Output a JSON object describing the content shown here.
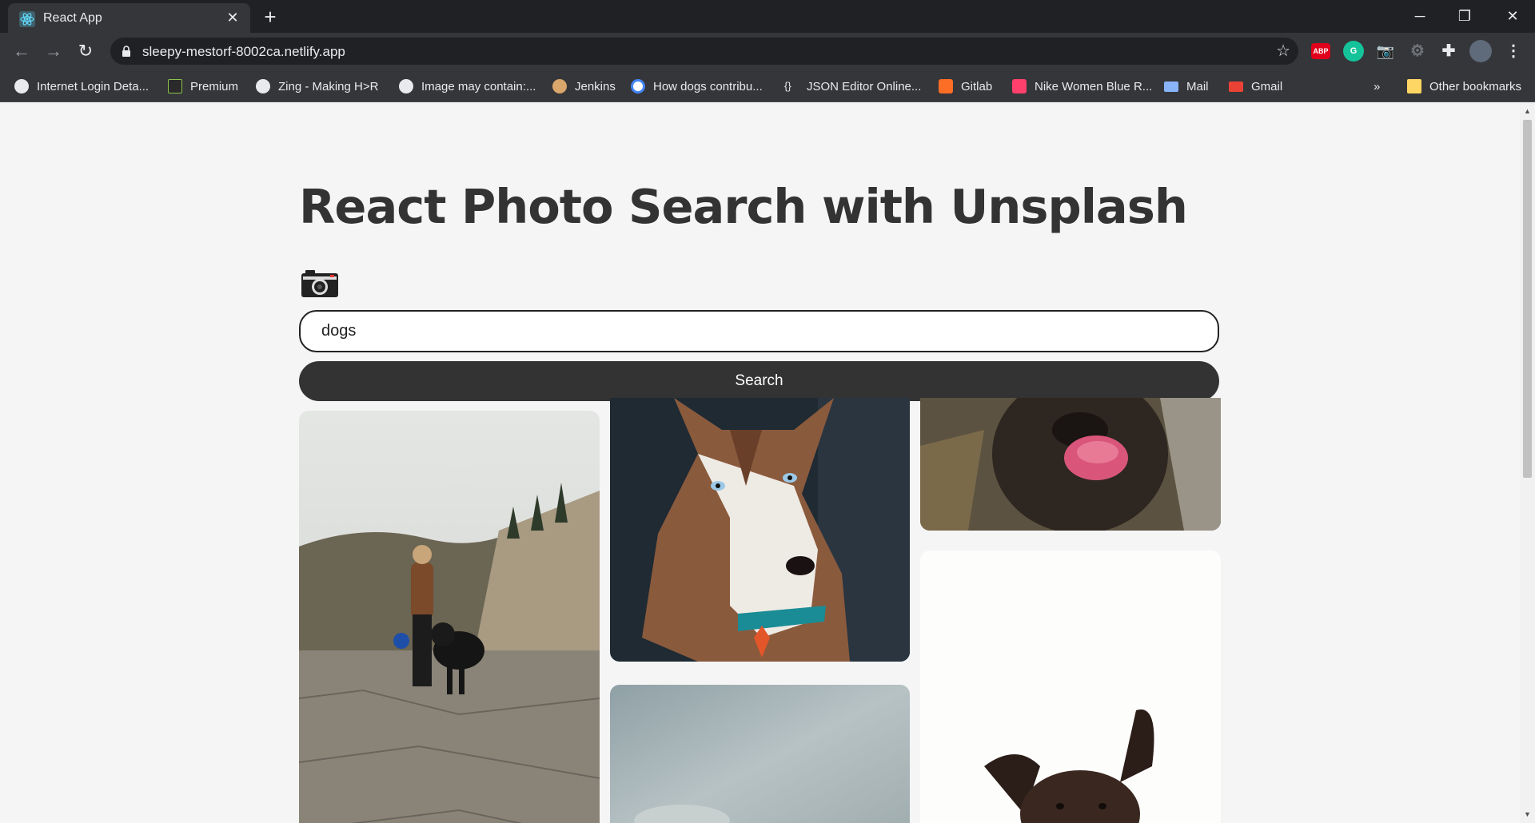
{
  "browser": {
    "tab_title": "React App",
    "url": "sleepy-mestorf-8002ca.netlify.app",
    "bookmarks": [
      {
        "label": "Internet Login Deta...",
        "icon": "globe-icon"
      },
      {
        "label": "Premium",
        "icon": "premium-icon"
      },
      {
        "label": "Zing - Making H>R",
        "icon": "globe-icon"
      },
      {
        "label": "Image may contain:...",
        "icon": "globe-icon"
      },
      {
        "label": "Jenkins",
        "icon": "jenkins-icon"
      },
      {
        "label": "How dogs contribu...",
        "icon": "google-icon"
      },
      {
        "label": "JSON Editor Online...",
        "icon": "json-icon"
      },
      {
        "label": "Gitlab",
        "icon": "gitlab-icon"
      },
      {
        "label": "Nike Women Blue R...",
        "icon": "myntra-icon"
      },
      {
        "label": "Mail",
        "icon": "mail-icon"
      },
      {
        "label": "Gmail",
        "icon": "gmail-icon"
      }
    ],
    "overflow_label": "»",
    "other_bookmarks": "Other bookmarks",
    "extensions": [
      {
        "label": "ABP",
        "icon": "adblock-icon"
      },
      {
        "label": "G",
        "icon": "grammarly-icon"
      }
    ]
  },
  "app": {
    "title": "React Photo Search with Unsplash",
    "search_value": "dogs",
    "search_button": "Search"
  },
  "photos": [
    {
      "subject": "woman-with-rottweiler"
    },
    {
      "subject": "husky-closeup"
    },
    {
      "subject": "dog-licking"
    },
    {
      "subject": "foggy-photo"
    },
    {
      "subject": "dark-dog-white-background"
    }
  ],
  "colors": {
    "page_bg": "#f5f5f5",
    "heading": "#333333",
    "button_bg": "#333333",
    "chrome_dark": "#202124",
    "chrome_toolbar": "#35363a"
  }
}
